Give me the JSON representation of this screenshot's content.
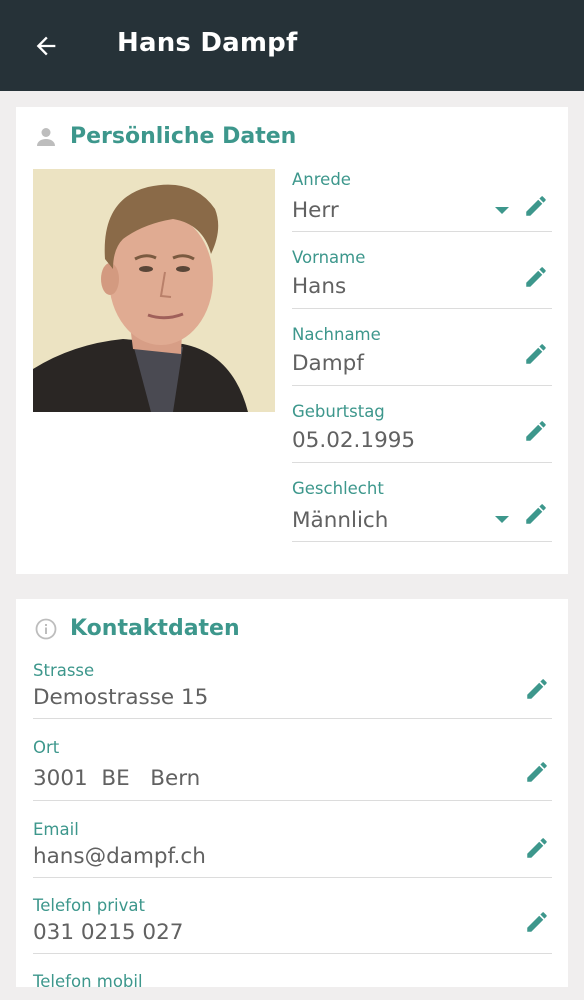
{
  "app_bar": {
    "title": "Hans Dampf",
    "back_icon": "arrow-left-icon",
    "background": "#263238"
  },
  "personal": {
    "title": "Persönliche Daten",
    "icon": "person-icon",
    "photo_alt": "Profile photo",
    "fields": [
      {
        "label": "Anrede",
        "value": "Herr",
        "type": "select"
      },
      {
        "label": "Vorname",
        "value": "Hans",
        "type": "text"
      },
      {
        "label": "Nachname",
        "value": "Dampf",
        "type": "text"
      },
      {
        "label": "Geburtstag",
        "value": "05.02.1995",
        "type": "text"
      },
      {
        "label": "Geschlecht",
        "value": "Männlich",
        "type": "select"
      }
    ]
  },
  "contact": {
    "title": "Kontaktdaten",
    "icon": "info-icon",
    "fields": [
      {
        "label": "Strasse",
        "value": "Demostrasse 15"
      },
      {
        "label": "Ort",
        "value": "3001  BE   Bern"
      },
      {
        "label": "Email",
        "value": "hans@dampf.ch"
      },
      {
        "label": "Telefon privat",
        "value": "031 0215 027"
      },
      {
        "label": "Telefon mobil",
        "value": ""
      }
    ]
  },
  "colors": {
    "accent": "#3d978c",
    "text": "#616161",
    "page_bg": "#f0eeee"
  }
}
